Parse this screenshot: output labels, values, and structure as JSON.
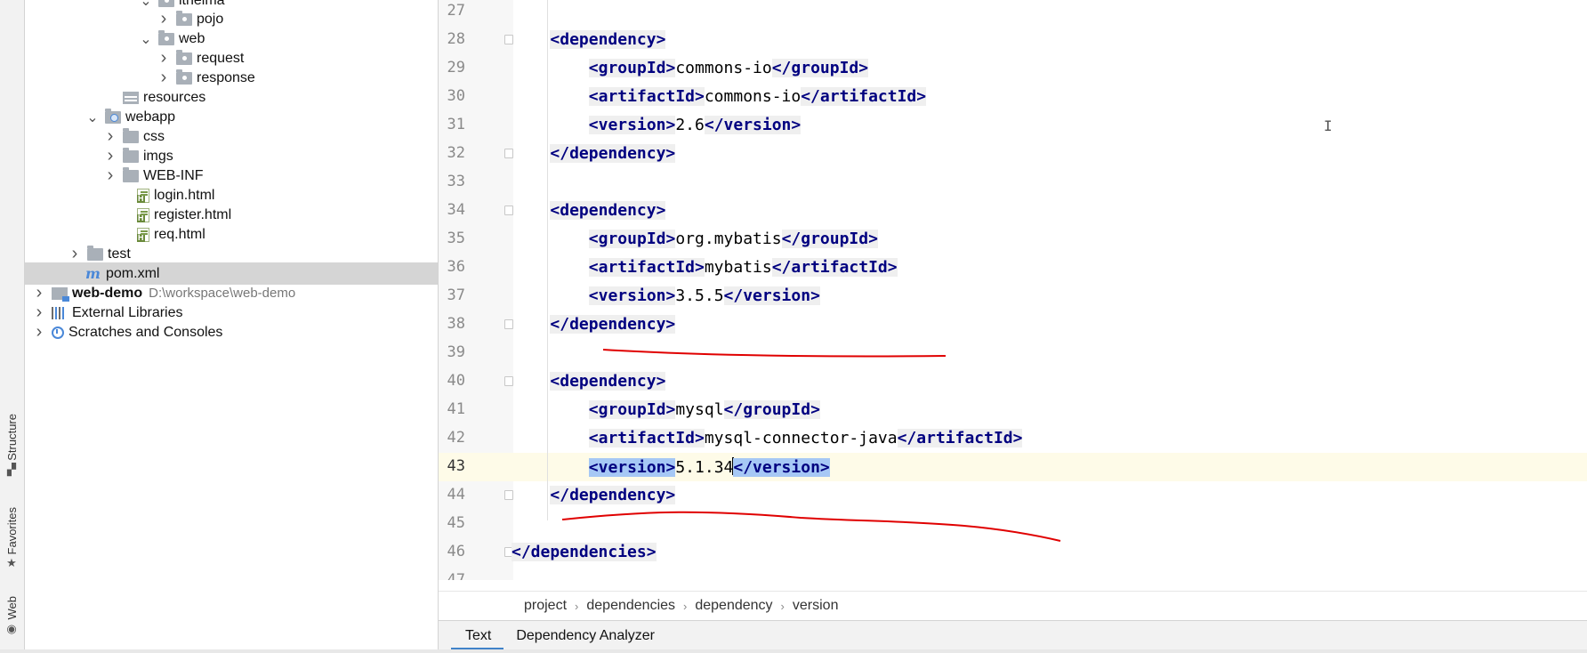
{
  "side_toolbar": {
    "structure_label": "Structure",
    "favorites_label": "Favorites",
    "web_label": "Web",
    "icons": [
      "structure-icon",
      "star-icon",
      "globe-icon"
    ]
  },
  "tree": {
    "items": [
      {
        "label": "itheima",
        "icon": "package-folder-icon",
        "chevron": "expanded"
      },
      {
        "label": "pojo",
        "icon": "package-folder-icon",
        "chevron": "collapsed"
      },
      {
        "label": "web",
        "icon": "package-folder-icon",
        "chevron": "expanded"
      },
      {
        "label": "request",
        "icon": "package-folder-icon",
        "chevron": "collapsed"
      },
      {
        "label": "response",
        "icon": "package-folder-icon",
        "chevron": "collapsed"
      },
      {
        "label": "resources",
        "icon": "resources-folder-icon",
        "chevron": "none"
      },
      {
        "label": "webapp",
        "icon": "web-folder-icon",
        "chevron": "expanded"
      },
      {
        "label": "css",
        "icon": "folder-icon",
        "chevron": "collapsed"
      },
      {
        "label": "imgs",
        "icon": "folder-icon",
        "chevron": "collapsed"
      },
      {
        "label": "WEB-INF",
        "icon": "folder-icon",
        "chevron": "collapsed"
      },
      {
        "label": "login.html",
        "icon": "html-file-icon",
        "chevron": "none"
      },
      {
        "label": "register.html",
        "icon": "html-file-icon",
        "chevron": "none"
      },
      {
        "label": "req.html",
        "icon": "html-file-icon",
        "chevron": "none"
      },
      {
        "label": "test",
        "icon": "folder-icon",
        "chevron": "collapsed"
      },
      {
        "label": "pom.xml",
        "icon": "maven-icon",
        "chevron": "none",
        "selected": true
      },
      {
        "label": "web-demo",
        "path": "D:\\workspace\\web-demo",
        "icon": "module-icon",
        "chevron": "collapsed"
      },
      {
        "label": "External Libraries",
        "icon": "libraries-icon",
        "chevron": "collapsed"
      },
      {
        "label": "Scratches and Consoles",
        "icon": "scratches-icon",
        "chevron": "collapsed"
      }
    ]
  },
  "editor": {
    "lines": [
      {
        "n": "27",
        "text": ""
      },
      {
        "n": "28",
        "text": "<dependency>"
      },
      {
        "n": "29",
        "text": "<groupId>commons-io</groupId>"
      },
      {
        "n": "30",
        "text": "<artifactId>commons-io</artifactId>"
      },
      {
        "n": "31",
        "text": "<version>2.6</version>"
      },
      {
        "n": "32",
        "text": "</dependency>"
      },
      {
        "n": "33",
        "text": ""
      },
      {
        "n": "34",
        "text": "<dependency>"
      },
      {
        "n": "35",
        "text": "<groupId>org.mybatis</groupId>"
      },
      {
        "n": "36",
        "text": "<artifactId>mybatis</artifactId>"
      },
      {
        "n": "37",
        "text": "<version>3.5.5</version>"
      },
      {
        "n": "38",
        "text": "</dependency>"
      },
      {
        "n": "39",
        "text": ""
      },
      {
        "n": "40",
        "text": "<dependency>"
      },
      {
        "n": "41",
        "text": "<groupId>mysql</groupId>"
      },
      {
        "n": "42",
        "text": "<artifactId>mysql-connector-java</artifactId>"
      },
      {
        "n": "43",
        "text": "<version>5.1.34</version>"
      },
      {
        "n": "44",
        "text": "</dependency>"
      },
      {
        "n": "45",
        "text": ""
      },
      {
        "n": "46",
        "text": "</dependencies>"
      },
      {
        "n": "47",
        "text": ""
      }
    ],
    "current_line": "43"
  },
  "breadcrumbs": [
    "project",
    "dependencies",
    "dependency",
    "version"
  ],
  "bottom_tabs": [
    {
      "label": "Text",
      "active": true
    },
    {
      "label": "Dependency Analyzer",
      "active": false
    }
  ],
  "colors": {
    "tag": "#000080",
    "selection": "#a6c8f5",
    "current_line": "#fefbe8",
    "annotation": "#e00000",
    "tab_underline": "#4083c9"
  }
}
